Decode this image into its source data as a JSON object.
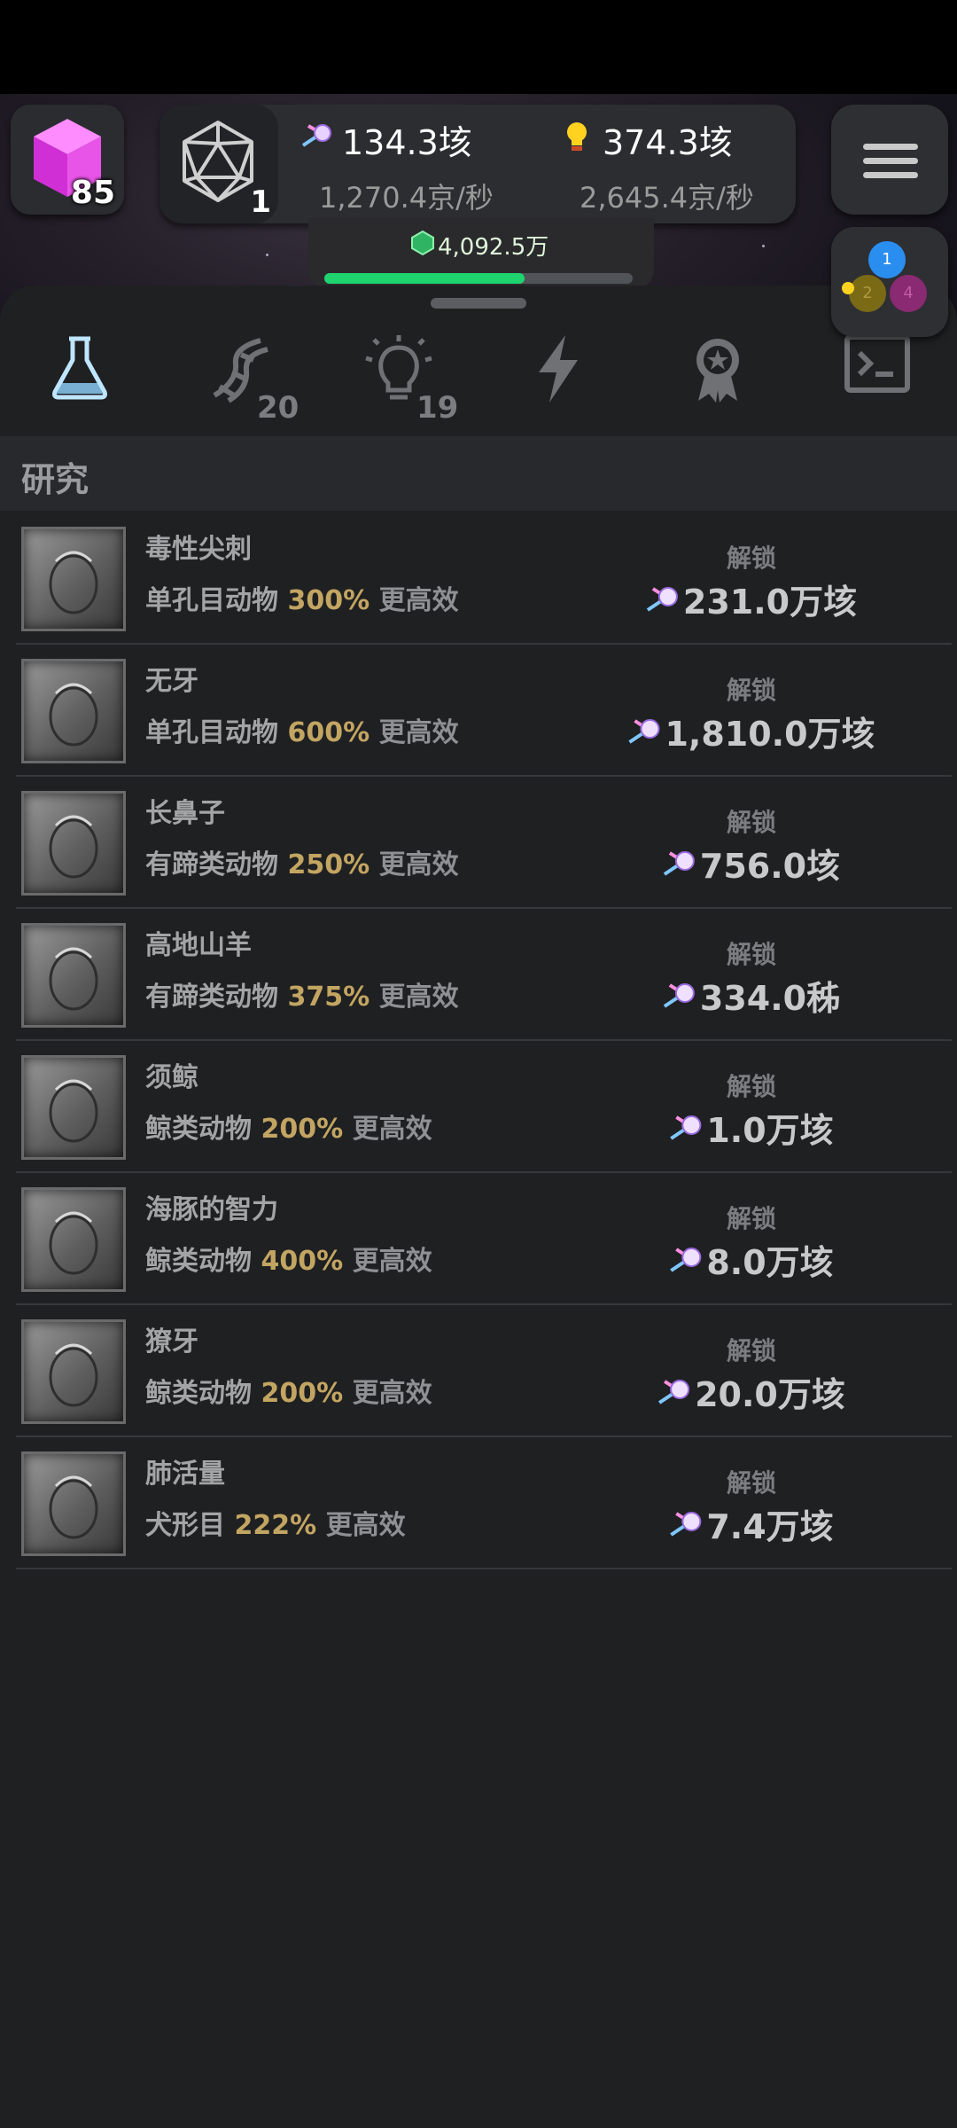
{
  "header": {
    "gem_count": "85",
    "d20_level": "1",
    "resource_a": {
      "icon": "comet-icon",
      "amount": "134.3垓",
      "rate": "1,270.4京/秒"
    },
    "resource_b": {
      "icon": "lightbulb-icon",
      "amount": "374.3垓",
      "rate": "2,645.4京/秒"
    },
    "score": {
      "icon": "green-gem-icon",
      "value": "4,092.5万",
      "progress": 0.65
    },
    "circles": [
      "1",
      "2",
      "4"
    ]
  },
  "tabs": [
    {
      "icon": "flask-icon",
      "badge": "",
      "active": true
    },
    {
      "icon": "dna-icon",
      "badge": "20",
      "active": false
    },
    {
      "icon": "lightbulb-icon",
      "badge": "19",
      "active": false
    },
    {
      "icon": "lightning-icon",
      "badge": "",
      "active": false
    },
    {
      "icon": "award-ribbon-icon",
      "badge": "",
      "active": false
    },
    {
      "icon": "terminal-icon",
      "badge": "",
      "active": false
    }
  ],
  "section": {
    "title": "研究"
  },
  "research": [
    {
      "title": "毒性尖刺",
      "group": "单孔目动物",
      "pct": "300%",
      "suffix": "更高效",
      "unlock": "解锁",
      "cost": "231.0万垓"
    },
    {
      "title": "无牙",
      "group": "单孔目动物",
      "pct": "600%",
      "suffix": "更高效",
      "unlock": "解锁",
      "cost": "1,810.0万垓"
    },
    {
      "title": "长鼻子",
      "group": "有蹄类动物",
      "pct": "250%",
      "suffix": "更高效",
      "unlock": "解锁",
      "cost": "756.0垓"
    },
    {
      "title": "高地山羊",
      "group": "有蹄类动物",
      "pct": "375%",
      "suffix": "更高效",
      "unlock": "解锁",
      "cost": "334.0秭"
    },
    {
      "title": "须鲸",
      "group": "鲸类动物",
      "pct": "200%",
      "suffix": "更高效",
      "unlock": "解锁",
      "cost": "1.0万垓"
    },
    {
      "title": "海豚的智力",
      "group": "鲸类动物",
      "pct": "400%",
      "suffix": "更高效",
      "unlock": "解锁",
      "cost": "8.0万垓"
    },
    {
      "title": "獠牙",
      "group": "鲸类动物",
      "pct": "200%",
      "suffix": "更高效",
      "unlock": "解锁",
      "cost": "20.0万垓"
    },
    {
      "title": "肺活量",
      "group": "犬形目",
      "pct": "222%",
      "suffix": "更高效",
      "unlock": "解锁",
      "cost": "7.4万垓"
    }
  ]
}
